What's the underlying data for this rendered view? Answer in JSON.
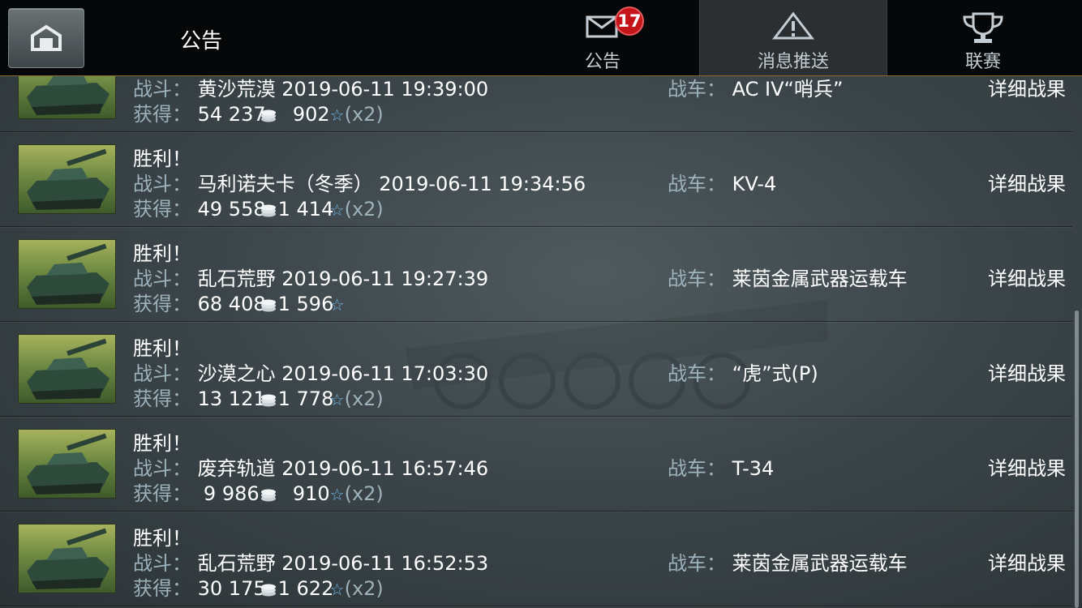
{
  "header": {
    "title": "公告",
    "tabs": [
      {
        "label": "公告",
        "icon": "envelope-icon",
        "badge": "17"
      },
      {
        "label": "消息推送",
        "icon": "warning-triangle-icon",
        "active": true
      },
      {
        "label": "联赛",
        "icon": "trophy-icon"
      }
    ]
  },
  "labels": {
    "result": "胜利！",
    "battle": "战斗：",
    "gain": "获得：",
    "tank": "战车：",
    "detail": "详细战果"
  },
  "rows": [
    {
      "result": "",
      "map": "黄沙荒漠",
      "time": "2019-06-11 19:39:00",
      "credits": "54 237",
      "xp": "902",
      "multiplier": "(x2)",
      "tank": "AC IV“哨兵”"
    },
    {
      "result": "胜利！",
      "map": "马利诺夫卡（冬季）",
      "time": "2019-06-11 19:34:56",
      "credits": "49 558",
      "xp": "1 414",
      "multiplier": "(x2)",
      "tank": "KV-4"
    },
    {
      "result": "胜利！",
      "map": "乱石荒野",
      "time": "2019-06-11 19:27:39",
      "credits": "68 408",
      "xp": "1 596",
      "multiplier": "",
      "tank": "莱茵金属武器运载车"
    },
    {
      "result": "胜利！",
      "map": "沙漠之心",
      "time": "2019-06-11 17:03:30",
      "credits": "13 121",
      "xp": "1 778",
      "multiplier": "(x2)",
      "tank": "“虎”式(P)"
    },
    {
      "result": "胜利！",
      "map": "废弃轨道",
      "time": "2019-06-11 16:57:46",
      "credits": "9 986",
      "xp": "910",
      "multiplier": "(x2)",
      "tank": "T-34"
    },
    {
      "result": "胜利！",
      "map": "乱石荒野",
      "time": "2019-06-11 16:52:53",
      "credits": "30 175",
      "xp": "1 622",
      "multiplier": "(x2)",
      "tank": "莱茵金属武器运载车"
    }
  ],
  "colors": {
    "topbar": "#060708",
    "badge": "#c51418",
    "label": "#9eb2bc",
    "star": "#6fb7e6"
  }
}
